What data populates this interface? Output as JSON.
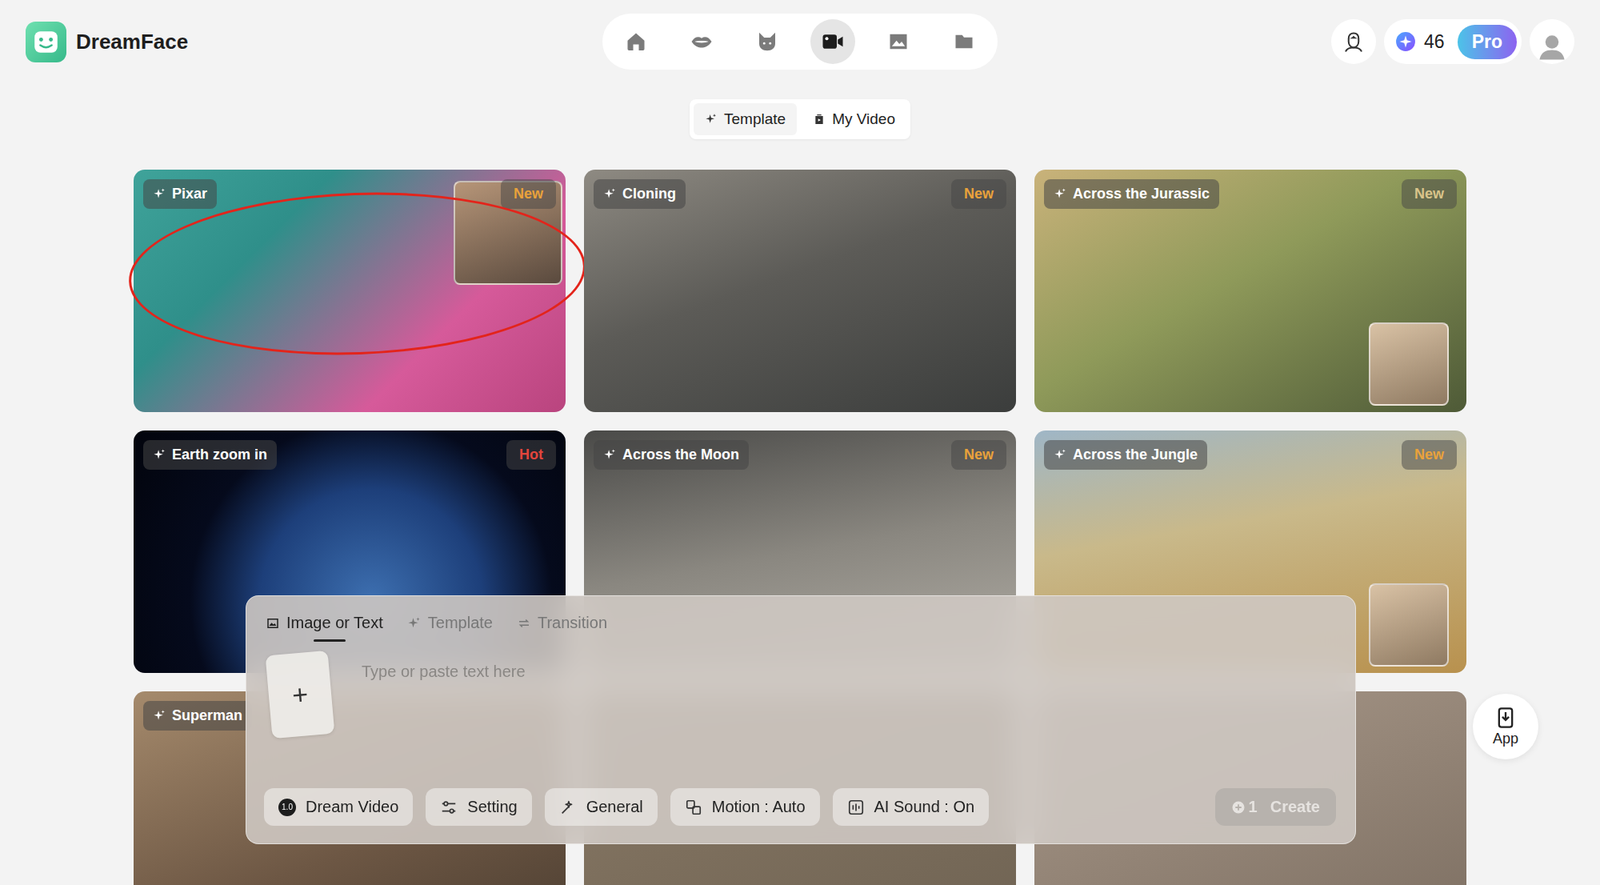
{
  "brand": {
    "name": "DreamFace"
  },
  "nav": [
    {
      "selected": false
    },
    {
      "selected": false
    },
    {
      "selected": false
    },
    {
      "selected": true
    },
    {
      "selected": false
    },
    {
      "selected": false
    }
  ],
  "account": {
    "credits": "46",
    "plan": "Pro"
  },
  "view_tabs": [
    {
      "label": "Template",
      "selected": true
    },
    {
      "label": "My Video",
      "selected": false
    }
  ],
  "cards": [
    {
      "title": "Pixar",
      "badge": "New",
      "color": "#e9a23b",
      "inset": true,
      "highlighted": true
    },
    {
      "title": "Cloning",
      "badge": "New",
      "color": "#e9a23b",
      "inset": false,
      "highlighted": false
    },
    {
      "title": "Across the Jurassic",
      "badge": "New",
      "color": "#d9c48a",
      "inset": true,
      "highlighted": false
    },
    {
      "title": "Earth zoom in",
      "badge": "Hot",
      "color": "#e2453c",
      "inset": false,
      "highlighted": false
    },
    {
      "title": "Across the Moon",
      "badge": "New",
      "color": "#e9a23b",
      "inset": false,
      "highlighted": false
    },
    {
      "title": "Across the Jungle",
      "badge": "New",
      "color": "#e9a23b",
      "inset": true,
      "highlighted": false
    },
    {
      "title": "Superman",
      "inset": false,
      "highlighted": false
    },
    {
      "inset": false,
      "highlighted": false
    },
    {
      "inset": false,
      "highlighted": false
    }
  ],
  "composer": {
    "tabs": [
      {
        "label": "Image or Text",
        "selected": true
      },
      {
        "label": "Template",
        "selected": false
      },
      {
        "label": "Transition",
        "selected": false
      }
    ],
    "upload_glyph": "+",
    "placeholder": "Type or paste text here",
    "model_version": "1.0",
    "tools": [
      {
        "label": "Dream Video",
        "kind": "model"
      },
      {
        "label": "Setting",
        "kind": "setting"
      },
      {
        "label": "General",
        "kind": "general"
      },
      {
        "label": "Motion : Auto",
        "kind": "motion"
      },
      {
        "label": "AI Sound : On",
        "kind": "sound"
      }
    ],
    "create": {
      "cost": "1",
      "label": "Create",
      "disabled": true
    }
  },
  "app_button": {
    "label": "App"
  }
}
